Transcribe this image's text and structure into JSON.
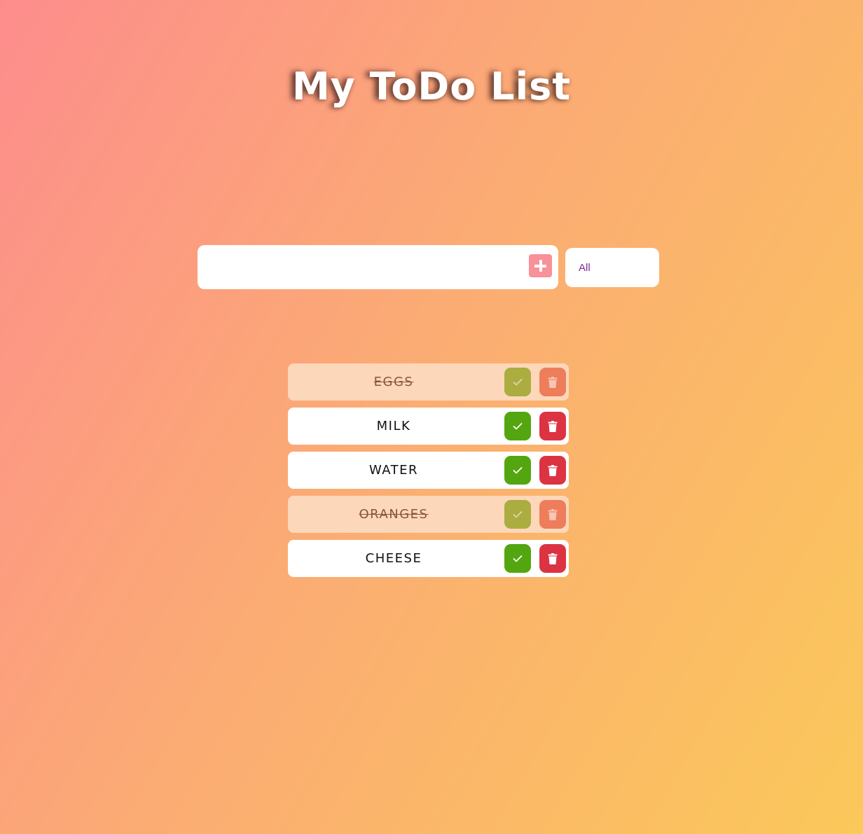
{
  "header": {
    "title": "My ToDo List"
  },
  "form": {
    "input_value": "",
    "add_icon": "plus-icon",
    "filter_selected": "All"
  },
  "todos": [
    {
      "text": "EGGS",
      "completed": true
    },
    {
      "text": "MILK",
      "completed": false
    },
    {
      "text": "WATER",
      "completed": false
    },
    {
      "text": "ORANGES",
      "completed": true
    },
    {
      "text": "CHEESE",
      "completed": false
    }
  ],
  "icons": {
    "complete": "check-icon",
    "delete": "trash-icon"
  },
  "colors": {
    "background_start": "#fd8d8c",
    "background_end": "#fbc85a",
    "add_button": "#f7919a",
    "check_button": "#53a60f",
    "trash_button": "#dc3343",
    "completed_item": "#fcd7b9",
    "filter_text": "#7b2aa0"
  }
}
